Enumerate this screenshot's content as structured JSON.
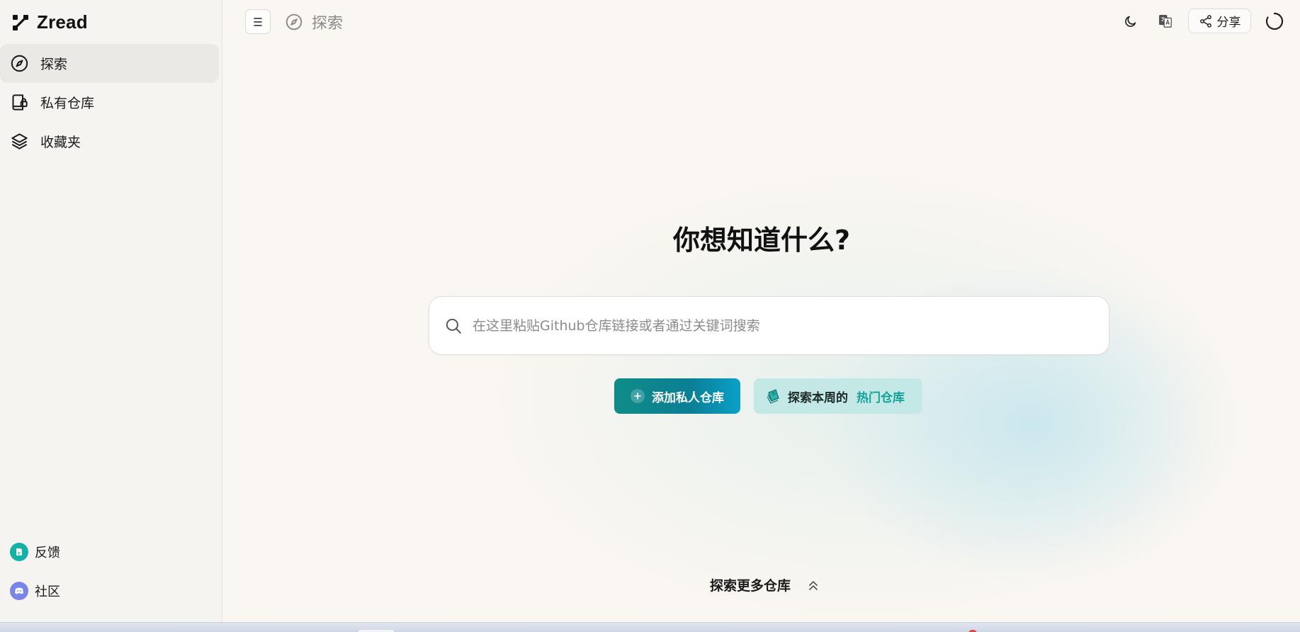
{
  "app": {
    "name": "Zread"
  },
  "sidebar": {
    "items": [
      {
        "label": "探索",
        "icon": "compass-icon",
        "active": true
      },
      {
        "label": "私有仓库",
        "icon": "private-repo-icon",
        "active": false
      },
      {
        "label": "收藏夹",
        "icon": "layers-icon",
        "active": false
      }
    ],
    "bottom": [
      {
        "label": "反馈",
        "icon": "feedback-icon",
        "color": "#14b1a6"
      },
      {
        "label": "社区",
        "icon": "discord-icon",
        "color": "#7a86e6"
      }
    ]
  },
  "header": {
    "breadcrumb": "探索",
    "share_label": "分享"
  },
  "main": {
    "title": "你想知道什么?",
    "search": {
      "placeholder": "在这里粘贴Github仓库链接或者通过关键词搜索",
      "value": ""
    },
    "primary_button": "添加私人仓库",
    "secondary_button": {
      "prefix": "探索本周的",
      "highlight": "热门仓库"
    },
    "explore_more": "探索更多仓库"
  },
  "colors": {
    "accent": "#14a39b",
    "primary_gradient_start": "#0f8c87",
    "primary_gradient_end": "#0aa0c8",
    "background": "#faf6f1"
  }
}
